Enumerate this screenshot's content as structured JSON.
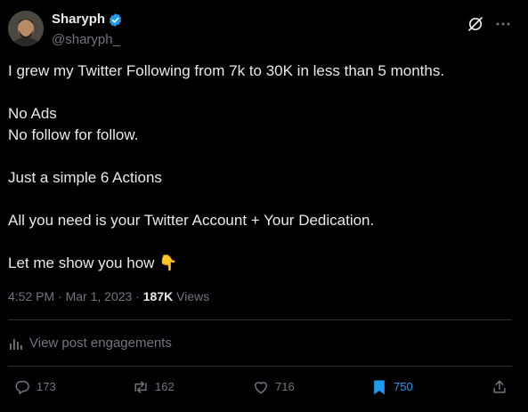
{
  "author": {
    "display_name": "Sharyph",
    "handle": "@sharyph_",
    "verified": true
  },
  "post": {
    "lines": [
      "I grew my Twitter Following from 7k to 30K in less than 5 months.",
      "No Ads",
      "No follow for follow.",
      "Just a simple 6 Actions",
      "All you need is your Twitter Account + Your Dedication.",
      "Let me show you how 👇"
    ]
  },
  "meta": {
    "time": "4:52 PM",
    "separator": "·",
    "date": "Mar 1, 2023",
    "views_count": "187K",
    "views_label": "Views"
  },
  "engagements_link": "View post engagements",
  "actions": {
    "replies": "173",
    "reposts": "162",
    "likes": "716",
    "bookmarks": "750"
  },
  "colors": {
    "background": "#000000",
    "text_primary": "#e7e9ea",
    "text_secondary": "#71767b",
    "accent": "#1d9bf0",
    "divider": "#2f3336"
  },
  "icons": [
    "verified-badge-icon",
    "grok-icon",
    "more-icon",
    "analytics-icon",
    "reply-icon",
    "repost-icon",
    "like-icon",
    "bookmark-icon",
    "share-icon"
  ]
}
